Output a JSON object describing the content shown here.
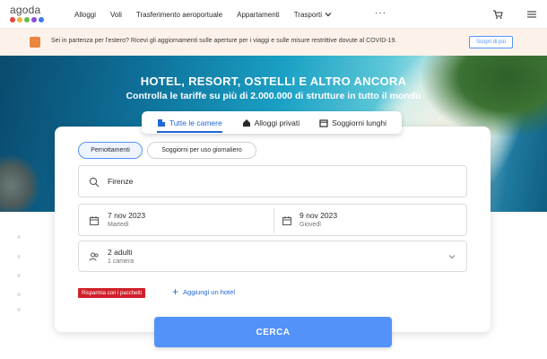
{
  "header": {
    "logo_text": "agoda",
    "logo_dot_colors": [
      "#e4473a",
      "#f3b23b",
      "#6bbc4a",
      "#8b4cd4",
      "#3b7de0"
    ],
    "nav": [
      "Alloggi",
      "Voli",
      "Trasferimento aeroportuale",
      "Appartamenti",
      "Trasporti"
    ],
    "more": "···",
    "icons": [
      "cart-icon",
      "hamburger-menu-icon"
    ]
  },
  "notice": {
    "text": "Sei in partenza per l'estero? Ricevi gli aggiornamenti sulle aperture per i viaggi e sulle misure restrittive dovute al COVID-19.",
    "button": "Scopri di più"
  },
  "hero": {
    "title": "HOTEL, RESORT, OSTELLI E ALTRO ANCORA",
    "subtitle": "Controlla le tariffe su più di 2.000.000 di strutture in tutto il mondo"
  },
  "tabs": [
    {
      "label": "Tutte le camere",
      "active": true,
      "icon": "building-icon"
    },
    {
      "label": "Alloggi privati",
      "active": false,
      "icon": "house-icon"
    },
    {
      "label": "Soggiorni lunghi",
      "active": false,
      "icon": "calendar-icon"
    }
  ],
  "search": {
    "mode_pills": [
      "Pernottamenti",
      "Soggiorni per uso giornaliero"
    ],
    "destination": "Firenze",
    "checkin": {
      "date": "7 nov 2023",
      "day": "Martedì"
    },
    "checkout": {
      "date": "9 nov 2023",
      "day": "Giovedì"
    },
    "guests": {
      "main": "2 adulti",
      "sub": "1 camera"
    },
    "deal_badge": "Risparmia con i pacchetti",
    "add_hotel": "Aggiungi un hotel",
    "button": "CERCA"
  },
  "colors": {
    "primary": "#5392f9",
    "link": "#2067da",
    "deal": "#d0202a",
    "notice_bg": "#fdf2e9"
  }
}
